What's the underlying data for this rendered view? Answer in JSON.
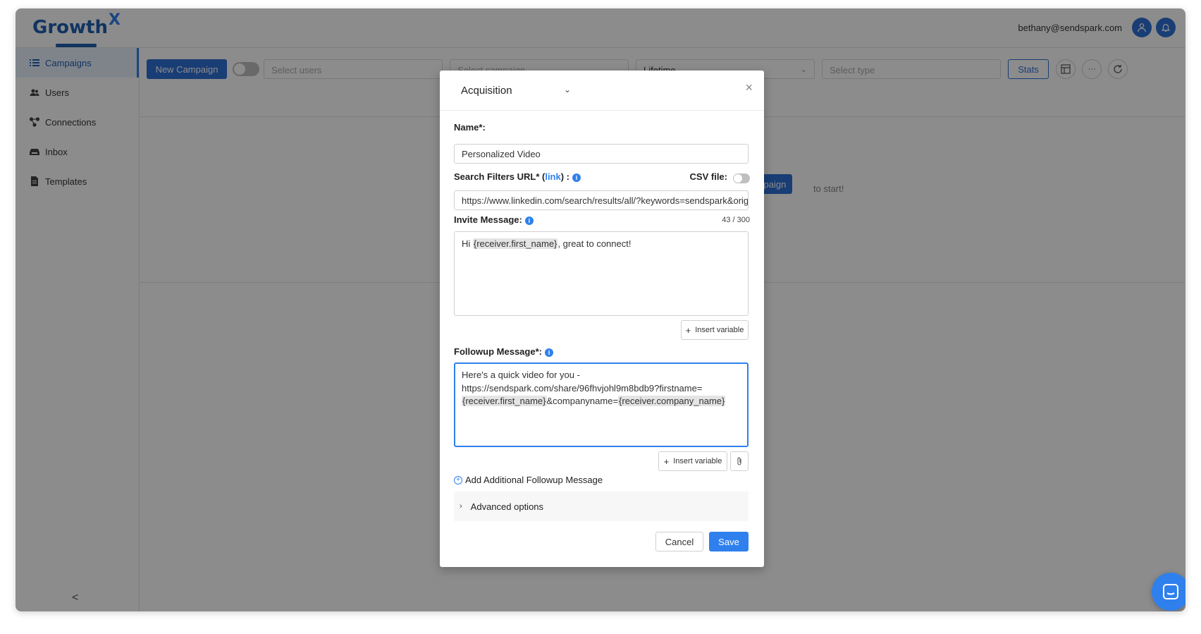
{
  "app": {
    "logo_text": "Growth",
    "logo_suffix": "X"
  },
  "header": {
    "user_email": "bethany@sendspark.com"
  },
  "sidebar": {
    "items": [
      {
        "label": "Campaigns",
        "icon": "list-icon"
      },
      {
        "label": "Users",
        "icon": "users-icon"
      },
      {
        "label": "Connections",
        "icon": "connections-icon"
      },
      {
        "label": "Inbox",
        "icon": "inbox-icon"
      },
      {
        "label": "Templates",
        "icon": "file-icon"
      }
    ],
    "collapse_label": "<"
  },
  "toolbar": {
    "new_campaign_label": "New Campaign",
    "select_users_placeholder": "Select users",
    "select_campaign_placeholder": "Select campaign",
    "period_value": "Lifetime",
    "select_type_placeholder": "Select type",
    "stats_label": "Stats",
    "more_label": "···"
  },
  "empty_state": {
    "button_label": "mpaign",
    "text": "to start!"
  },
  "modal": {
    "title": "Acquisition",
    "close_label": "×",
    "name_label": "Name*:",
    "name_value": "Personalized Video",
    "search_url_label_prefix": "Search Filters URL* (",
    "search_url_link": "link",
    "search_url_label_suffix": ") :",
    "csv_label": "CSV file:",
    "search_url_value": "https://www.linkedin.com/search/results/all/?keywords=sendspark&origin",
    "invite_label": "Invite Message:",
    "invite_counter": "43 / 300",
    "invite_text_prefix": "Hi ",
    "invite_var": "{receiver.first_name}",
    "invite_text_suffix": ", great to connect!",
    "insert_variable_label": "Insert variable",
    "followup_label": "Followup Message*:",
    "followup_line1": "Here's a quick video for you -",
    "followup_line2": "https://sendspark.com/share/96fhvjohl9m8bdb9?firstname=",
    "followup_var1": "{receiver.first_name}",
    "followup_mid": "&companyname=",
    "followup_var2": "{receiver.company_name}",
    "add_followup_label": "Add Additional Followup Message",
    "advanced_label": "Advanced options",
    "cancel_label": "Cancel",
    "save_label": "Save"
  },
  "colors": {
    "primary": "#2f6fd6",
    "accent": "#2f80ed",
    "overlay": "rgba(0,0,0,0.45)"
  }
}
